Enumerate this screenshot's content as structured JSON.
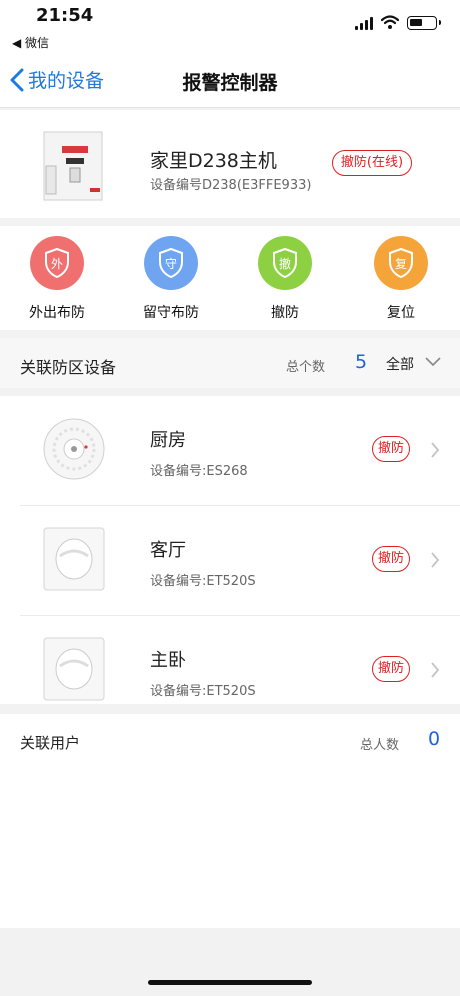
{
  "status_bar": {
    "time": "21:54",
    "back_app": "◀ 微信"
  },
  "nav": {
    "back_label": "我的设备",
    "title": "报警控制器"
  },
  "device": {
    "name": "家里D238主机",
    "id": "设备编号D238(E3FFE933)",
    "status": "撤防(在线)",
    "status_color": "#e02020"
  },
  "actions": [
    {
      "label": "外出布防",
      "glyph": "外",
      "color": "#f07070"
    },
    {
      "label": "留守布防",
      "glyph": "守",
      "color": "#6fa5f0"
    },
    {
      "label": "撤防",
      "glyph": "撤",
      "color": "#8dd142"
    },
    {
      "label": "复位",
      "glyph": "复",
      "color": "#f5a43a"
    }
  ],
  "zone_section": {
    "title": "关联防区设备",
    "count_label": "总个数",
    "count": "5",
    "filter": "全部"
  },
  "zones": [
    {
      "name": "厨房",
      "id": "设备编号:ES268",
      "status": "撤防",
      "icon": "smoke-detector-icon"
    },
    {
      "name": "客厅",
      "id": "设备编号:ET520S",
      "status": "撤防",
      "icon": "pir-sensor-icon"
    },
    {
      "name": "主卧",
      "id": "设备编号:ET520S",
      "status": "撤防",
      "icon": "pir-sensor-icon"
    }
  ],
  "users_section": {
    "title": "关联用户",
    "count_label": "总人数",
    "count": "0"
  },
  "colors": {
    "accent": "#1f7ae0",
    "count_blue": "#1f63d8",
    "alert_red": "#e02020"
  }
}
